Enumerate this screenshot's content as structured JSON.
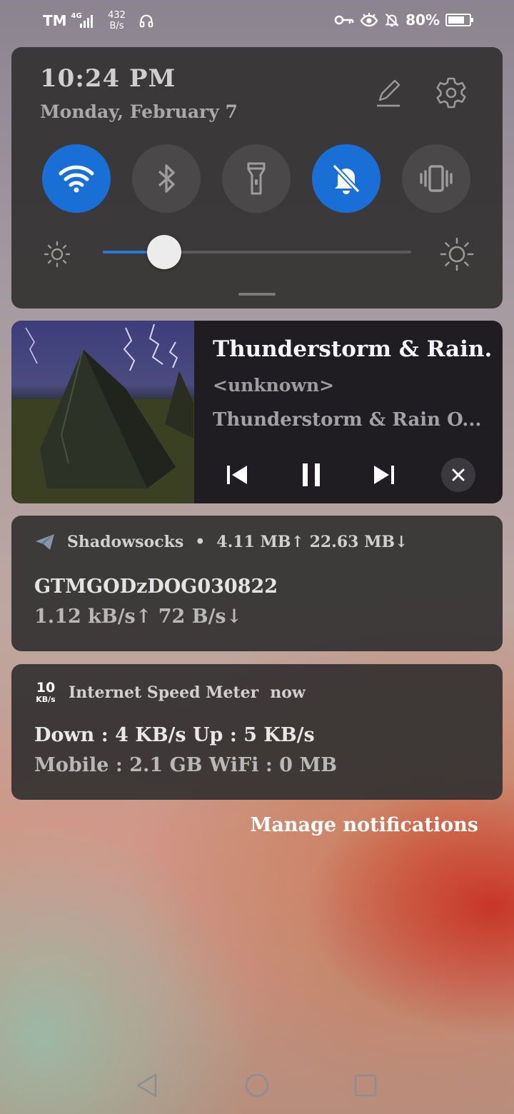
{
  "status_bar": {
    "carrier": "TM",
    "network": "4G",
    "speed_value": "432",
    "speed_unit": "B/s",
    "battery": "80%",
    "icons": [
      "headset-icon",
      "vpn-key-icon",
      "eye-icon",
      "bell-off-icon",
      "battery-icon"
    ]
  },
  "quick_settings": {
    "time": "10:24 PM",
    "date": "Monday, February 7",
    "tiles": [
      {
        "name": "wifi",
        "icon": "wifi-icon",
        "on": true
      },
      {
        "name": "bluetooth",
        "icon": "bluetooth-icon",
        "on": false
      },
      {
        "name": "flashlight",
        "icon": "flashlight-icon",
        "on": false
      },
      {
        "name": "do-not-disturb",
        "icon": "bell-off-icon",
        "on": true
      },
      {
        "name": "vibrate",
        "icon": "vibrate-icon",
        "on": false
      }
    ],
    "brightness_level": 0.2,
    "accent_color": "#1a6fd6"
  },
  "media": {
    "title": "Thunderstorm & Rain...",
    "artist": "<unknown>",
    "album": "Thunderstorm & Rain O...",
    "controls": [
      "previous-icon",
      "pause-icon",
      "next-icon",
      "close-icon"
    ]
  },
  "notifications": [
    {
      "app": "Shadowsocks",
      "separator": "•",
      "summary": "4.11 MB↑ 22.63 MB↓",
      "line1": "GTMGODzDOG030822",
      "line2": "1.12 kB/s↑  72 B/s↓"
    },
    {
      "app": "Internet Speed Meter",
      "time": "now",
      "icon_value": "10",
      "icon_unit": "KB/s",
      "line1": "Down :  4 KB/s   Up :  5 KB/s",
      "line2": "Mobile : 2.1 GB   WiFi : 0 MB"
    }
  ],
  "manage_label": "Manage notifications",
  "nav": [
    "back-icon",
    "home-icon",
    "recents-icon"
  ]
}
